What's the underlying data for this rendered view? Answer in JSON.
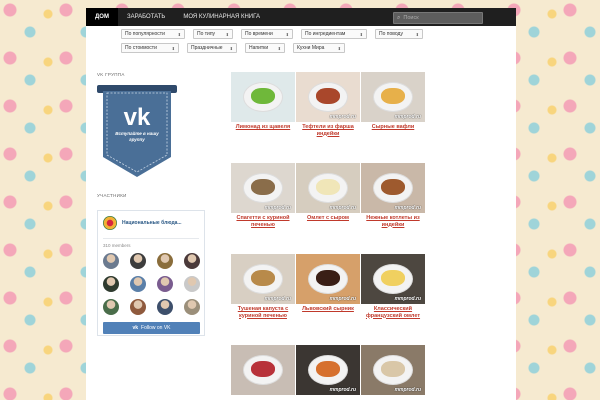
{
  "nav": {
    "items": [
      "Дом",
      "Заработать",
      "Моя кулинарная книга"
    ],
    "search_placeholder": "Поиск"
  },
  "filters": {
    "row1": [
      "По популярности",
      "По типу",
      "По времени",
      "По ингредиентам",
      "По поводу"
    ],
    "row2": [
      "По стоимости",
      "Праздничные",
      "Напитки",
      "Кухни Мира"
    ]
  },
  "sidebar": {
    "vk_group_title": "VK группа",
    "vk_badge_text": "Вступайте в нашу группу",
    "members_title": "Участники",
    "group_name": "Национальные блюда...",
    "members_count": "310 members",
    "follow_label": "Follow on VK",
    "avatar_colors": [
      "#6b7a8f",
      "#3d3d3d",
      "#8a6d3b",
      "#4b3a3a",
      "#2f3b2f",
      "#5a7fa8",
      "#7a5c8f",
      "#c9c9c9",
      "#4a6d4a",
      "#8f5a3d",
      "#3d4f6b",
      "#9b8f7a"
    ]
  },
  "recipes": [
    {
      "title": "Лимонад из щавеля",
      "watermark": "",
      "bg": "#dfe9ea",
      "food": "#6fb83a"
    },
    {
      "title": "Тефтели из фарша индейки",
      "watermark": "mmprod.ru",
      "bg": "#e9dcd0",
      "food": "#a9472b"
    },
    {
      "title": "Сырные вафли",
      "watermark": "mmprod.ru",
      "bg": "#d9d2c9",
      "food": "#e7b04a"
    },
    {
      "title": "Спагетти с куриной печенью",
      "watermark": "mmprod.ru",
      "bg": "#ddd7cf",
      "food": "#8a6d4a"
    },
    {
      "title": "Омлет с сыром",
      "watermark": "mmprod.ru",
      "bg": "#d6cdbf",
      "food": "#f0e6b8"
    },
    {
      "title": "Нежные котлеты из индейки",
      "watermark": "mmprod.ru",
      "bg": "#c9b8a8",
      "food": "#9e5a2e"
    },
    {
      "title": "Тушеная капуста с куриной печенью",
      "watermark": "mmprod.ru",
      "bg": "#d8cfc3",
      "food": "#b88a4a"
    },
    {
      "title": "Львовский сырник",
      "watermark": "mmprod.ru",
      "bg": "#d6a06a",
      "food": "#3a1f16"
    },
    {
      "title": "Классический французский омлет",
      "watermark": "mmprod.ru",
      "bg": "#4d4740",
      "food": "#f0d060"
    },
    {
      "title": "",
      "watermark": "",
      "bg": "#c8bdb4",
      "food": "#b8323a"
    },
    {
      "title": "",
      "watermark": "mmprod.ru",
      "bg": "#3b3632",
      "food": "#d6702e"
    },
    {
      "title": "",
      "watermark": "mmprod.ru",
      "bg": "#8a7a68",
      "food": "#d9c7a8"
    }
  ]
}
